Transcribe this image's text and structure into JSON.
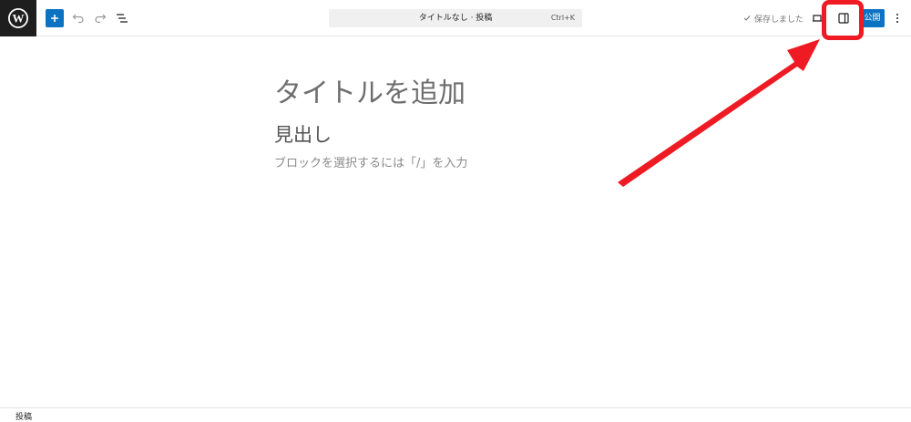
{
  "header": {
    "document_title": "タイトルなし · 投稿",
    "shortcut": "Ctrl+K",
    "saved_label": "保存しました",
    "publish_label": "公開"
  },
  "editor": {
    "title_placeholder": "タイトルを追加",
    "heading_text": "見出し",
    "block_placeholder": "ブロックを選択するには「/」を入力"
  },
  "footer": {
    "breadcrumb": "投稿"
  },
  "annotation": {
    "highlight_color": "#ee1b24",
    "target": "settings-toggle-icon"
  },
  "colors": {
    "accent": "#0b73c2",
    "logo_bg": "#1e1e1e"
  }
}
